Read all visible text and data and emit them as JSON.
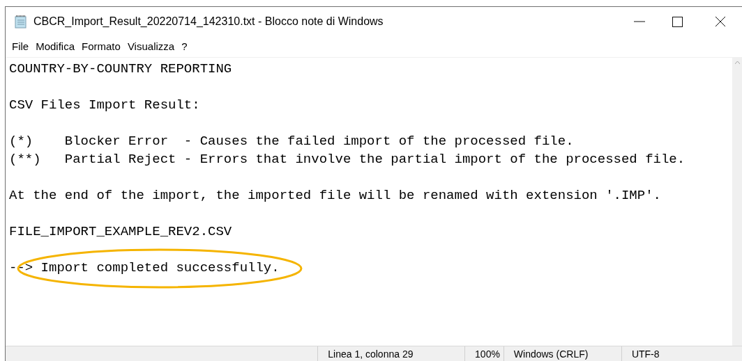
{
  "window": {
    "title": "CBCR_Import_Result_20220714_142310.txt - Blocco note di Windows"
  },
  "menu": [
    "File",
    "Modifica",
    "Formato",
    "Visualizza",
    "?"
  ],
  "document": {
    "blocks": [
      {
        "lines": [
          "COUNTRY-BY-COUNTRY REPORTING"
        ]
      },
      {
        "lines": [
          "CSV Files Import Result:"
        ]
      },
      {
        "lines": [
          "(*)    Blocker Error  - Causes the failed import of the processed file.",
          "(**)   Partial Reject - Errors that involve the partial import of the processed file."
        ]
      },
      {
        "lines": [
          "At the end of the import, the imported file will be renamed with extension '.IMP'."
        ]
      },
      {
        "lines": [
          "FILE_IMPORT_EXAMPLE_REV2.CSV"
        ]
      },
      {
        "lines": [
          "--> Import completed successfully."
        ],
        "highlight": {
          "kind": "ellipse",
          "color": "#f5b400"
        }
      }
    ]
  },
  "status_bar": [
    "Linea 1, colonna 29",
    "100%",
    "Windows (CRLF)",
    "UTF-8"
  ]
}
